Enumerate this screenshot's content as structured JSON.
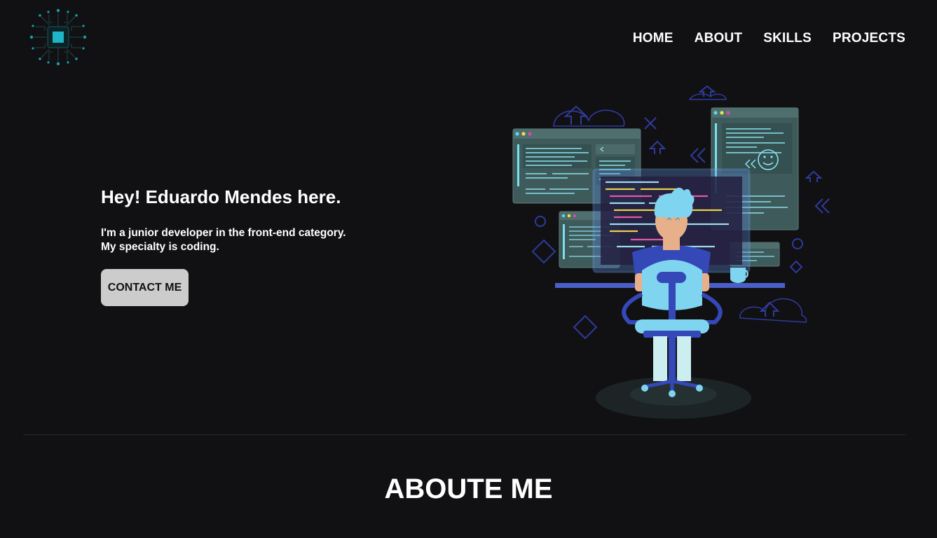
{
  "nav": {
    "items": [
      {
        "label": "HOME"
      },
      {
        "label": "ABOUT"
      },
      {
        "label": "SKILLS"
      },
      {
        "label": "PROJECTS"
      }
    ]
  },
  "hero": {
    "title": "Hey! Eduardo Mendes here.",
    "description_line1": "I'm a junior developer in the front-end category.",
    "description_line2": "My specialty is coding.",
    "cta_label": "CONTACT ME"
  },
  "about": {
    "title": "ABOUTE ME"
  },
  "icons": {
    "logo": "cpu-chip-icon",
    "illustration": "developer-at-desk-illustration"
  },
  "colors": {
    "background": "#111113",
    "accent": "#1fb5c9",
    "button": "#cccccc",
    "text": "#ffffff"
  }
}
